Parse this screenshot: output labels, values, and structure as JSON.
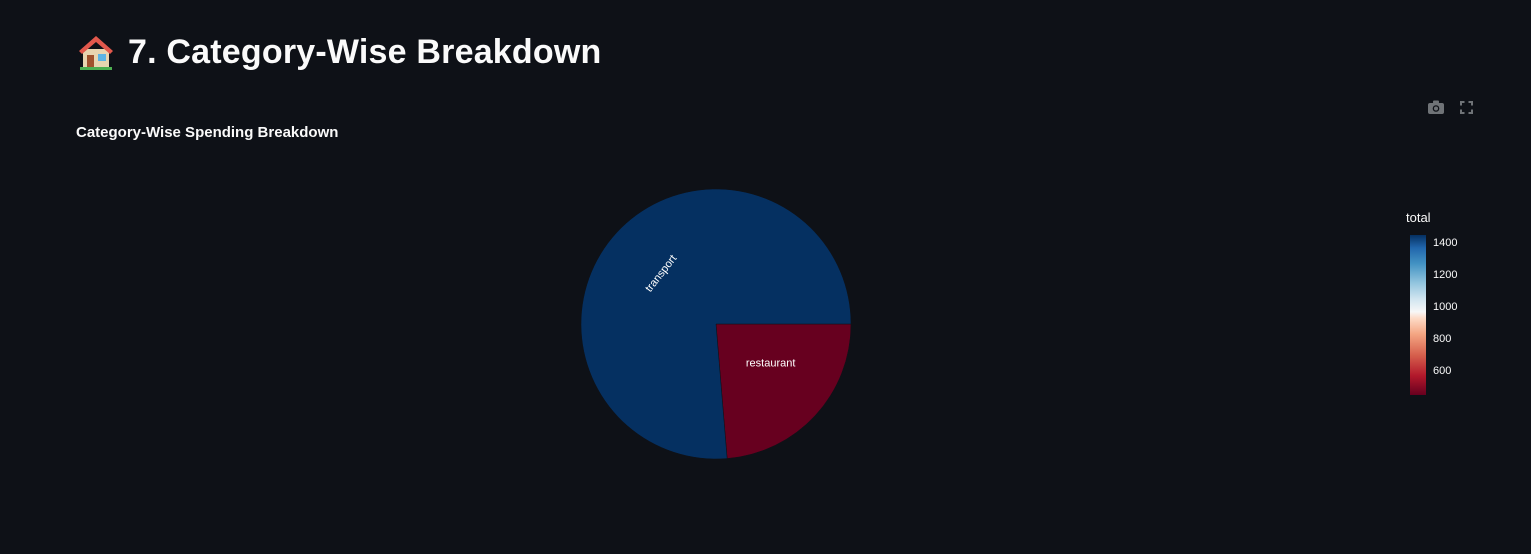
{
  "header": {
    "emoji_icon": "house-icon",
    "title": "7. Category-Wise Breakdown"
  },
  "toolbar": {
    "camera_icon": "camera-icon",
    "fullscreen_icon": "fullscreen-icon"
  },
  "chart_data": {
    "type": "pie",
    "title": "Category-Wise Spending Breakdown",
    "slices": [
      {
        "label": "transport",
        "value": 1450,
        "color": "#053061"
      },
      {
        "label": "restaurant",
        "value": 450,
        "color": "#67001f"
      }
    ],
    "colorbar": {
      "title": "total",
      "ticks": [
        "1400",
        "1200",
        "1000",
        "800",
        "600"
      ],
      "tick_values": [
        1400,
        1200,
        1000,
        800,
        600
      ],
      "range": [
        450,
        1450
      ]
    }
  }
}
